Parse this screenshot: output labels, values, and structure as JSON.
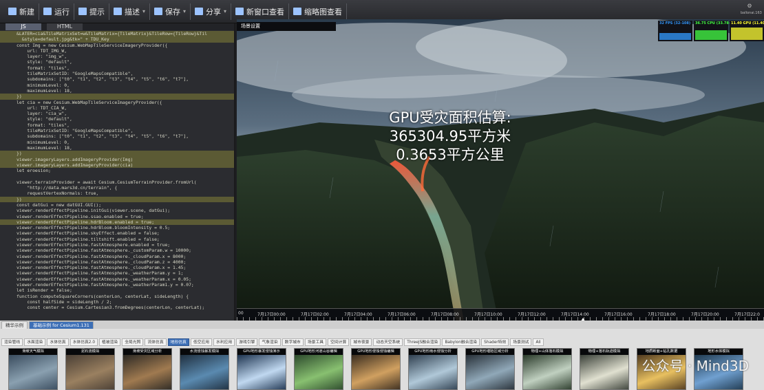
{
  "toolbar": {
    "buttons": [
      {
        "label": "新建",
        "icon": "new-file-icon"
      },
      {
        "label": "运行",
        "icon": "run-icon"
      },
      {
        "label": "提示",
        "icon": "hint-icon"
      },
      {
        "label": "描述",
        "icon": "describe-icon",
        "dropdown": true
      },
      {
        "label": "保存",
        "icon": "save-icon",
        "dropdown": true
      },
      {
        "label": "分享",
        "icon": "share-icon",
        "dropdown": true
      },
      {
        "label": "新窗口查看",
        "icon": "new-window-icon"
      },
      {
        "label": "缩略图查看",
        "icon": "thumbnail-icon"
      }
    ],
    "logo_text": "ballonai.163"
  },
  "editor": {
    "tabs": [
      "JS",
      "HTML"
    ],
    "active_tab": "JS",
    "lines": [
      {
        "n": "",
        "t": "&LATER=cia&TileMatrixSet=w&TileMatrix={TileMatrix}&TileRow={TileRow}&Til",
        "hl": true
      },
      {
        "n": "",
        "t": "  &style=default.jpg&tk=\" + TDU_Key",
        "hl": true
      },
      {
        "n": "",
        "t": "const Img = new Cesium.WebMapTileServiceImageryProvider({",
        "hl": false
      },
      {
        "n": "",
        "t": "    url: TDT_IMG_W,",
        "hl": false
      },
      {
        "n": "",
        "t": "    layer: \"img_w\",",
        "hl": false
      },
      {
        "n": "",
        "t": "    style: \"default\",",
        "hl": false
      },
      {
        "n": "",
        "t": "    format: \"tiles\",",
        "hl": false
      },
      {
        "n": "",
        "t": "    tileMatrixSetID: \"GoogleMapsCompatible\",",
        "hl": false
      },
      {
        "n": "",
        "t": "    subdomains: [\"t0\", \"t1\", \"t2\", \"t3\", \"t4\", \"t5\", \"t6\", \"t7\"],",
        "hl": false
      },
      {
        "n": "",
        "t": "    minimumLevel: 0,",
        "hl": false
      },
      {
        "n": "",
        "t": "    maximumLevel: 18,",
        "hl": false
      },
      {
        "n": "",
        "t": "})",
        "hl": true
      },
      {
        "n": "",
        "t": "let cia = new Cesium.WebMapTileServiceImageryProvider({",
        "hl": false
      },
      {
        "n": "",
        "t": "    url: TDT_CIA_W,",
        "hl": false
      },
      {
        "n": "",
        "t": "    layer: \"cia_w\",",
        "hl": false
      },
      {
        "n": "",
        "t": "    style: \"default\",",
        "hl": false
      },
      {
        "n": "",
        "t": "    format: \"tiles\",",
        "hl": false
      },
      {
        "n": "",
        "t": "    tileMatrixSetID: \"GoogleMapsCompatible\",",
        "hl": false
      },
      {
        "n": "",
        "t": "    subdomains: [\"t0\", \"t1\", \"t2\", \"t3\", \"t4\", \"t5\", \"t6\", \"t7\"],",
        "hl": false
      },
      {
        "n": "",
        "t": "    minimumLevel: 0,",
        "hl": false
      },
      {
        "n": "",
        "t": "    maximumLevel: 18,",
        "hl": false
      },
      {
        "n": "",
        "t": "})",
        "hl": true
      },
      {
        "n": "",
        "t": "viewer.imageryLayers.addImageryProvider(Img)",
        "hl": true
      },
      {
        "n": "",
        "t": "viewer.imageryLayers.addImageryProvider(cia)",
        "hl": true
      },
      {
        "n": "",
        "t": "let eroesion;",
        "hl": false
      },
      {
        "n": "",
        "t": "",
        "hl": false
      },
      {
        "n": "",
        "t": "viewer.terrainProvider = await Cesium.CesiumTerrainProvider.fromUrl(",
        "hl": false
      },
      {
        "n": "",
        "t": "    \"http://data.mars3d.cn/terrain\", {",
        "hl": false
      },
      {
        "n": "",
        "t": "    requestVertexNormals: true,",
        "hl": false
      },
      {
        "n": "",
        "t": "})",
        "hl": true
      },
      {
        "n": "",
        "t": "const datGui = new datGUI.GUI();",
        "hl": false
      },
      {
        "n": "",
        "t": "viewer.renderEffectPipeline.initGui(viewer.scene, datGui);",
        "hl": false
      },
      {
        "n": "",
        "t": "viewer.renderEffectPipeline.ssao.enabled = true;",
        "hl": false
      },
      {
        "n": "",
        "t": "viewer.renderEffectPipeline.hdrBloom.enabled = true;",
        "hl": true
      },
      {
        "n": "",
        "t": "viewer.renderEffectPipeline.hdrBloom.bloomIntensity = 0.5;",
        "hl": false
      },
      {
        "n": "",
        "t": "viewer.renderEffectPipeline.skyEffect.enabled = false;",
        "hl": false
      },
      {
        "n": "",
        "t": "viewer.renderEffectPipeline.tiltshift.enabled = false;",
        "hl": false
      },
      {
        "n": "",
        "t": "viewer.renderEffectPipeline.fastAtmosphere.enabled = true;",
        "hl": false
      },
      {
        "n": "",
        "t": "viewer.renderEffectPipeline.fastAtmosphere._customParam.w = 10000;",
        "hl": false
      },
      {
        "n": "",
        "t": "viewer.renderEffectPipeline.fastAtmosphere._cloudParam.x = 8000;",
        "hl": false
      },
      {
        "n": "",
        "t": "viewer.renderEffectPipeline.fastAtmosphere._cloudParam.z = 4000;",
        "hl": false
      },
      {
        "n": "",
        "t": "viewer.renderEffectPipeline.fastAtmosphere._cloudParam.x = 1.45;",
        "hl": false
      },
      {
        "n": "",
        "t": "viewer.renderEffectPipeline.fastAtmosphere._weatherParam.y = 1;",
        "hl": false
      },
      {
        "n": "",
        "t": "viewer.renderEffectPipeline.fastAtmosphere._weatherParam.x = 0.05;",
        "hl": false
      },
      {
        "n": "",
        "t": "viewer.renderEffectPipeline.fastAtmosphere._weatherParam1.y = 0.07;",
        "hl": false
      },
      {
        "n": "",
        "t": "let isRender = false;",
        "hl": false
      },
      {
        "n": "",
        "t": "function computeSquareCorners(centerLon, centerLat, sideLength) {",
        "hl": false
      },
      {
        "n": "",
        "t": "    const halfSide = sideLength / 2;",
        "hl": false
      },
      {
        "n": "",
        "t": "    const center = Cesium.Cartesian3.fromDegrees(centerLon, centerLat);",
        "hl": false
      }
    ]
  },
  "scene": {
    "label": "场景设置",
    "perf": [
      "32 FPS (32-108)",
      "36.75 CPU (33.78-43)",
      "11.40 GPU (11.40-27)"
    ],
    "overlay": [
      "GPU受灾面积估算:",
      "365304.95平方米",
      "0.3653平方公里"
    ]
  },
  "timeline": {
    "ticks": [
      "00",
      "7月17日00:00",
      "7月17日02:00",
      "7月17日04:00",
      "7月17日06:00",
      "7月17日08:00",
      "7月17日10:00",
      "7月17日12:00",
      "7月17日14:00",
      "7月17日16:00",
      "7月17日18:00",
      "7月17日20:00",
      "7月17日22:0"
    ]
  },
  "bottom": {
    "tabs1": [
      "精华示例",
      "基础示例 for Cesium1.131"
    ],
    "tabs2": [
      "渲染管线",
      "水面渲染",
      "水体仿真",
      "水体仿真2.0",
      "植被渲染",
      "全局光照",
      "流体仿真",
      "地形仿真",
      "低空应用",
      "水利应用",
      "游戏引擎",
      "气象渲染",
      "数字城市",
      "场景工具",
      "空间计算",
      "城市夜景",
      "动态天空系统",
      "ThreeJS融合渲染",
      "Babylon融合渲染",
      "Shader特效",
      "场景测试",
      "All"
    ],
    "active_tab2": "地形仿真",
    "cards": [
      "滑坡天气模拟",
      "泥石流模拟",
      "滑坡受灾区域分析",
      "水流侵蚀暴发模拟",
      "GPU地形暴发侵蚀演示",
      "GPU地形河道山谷编辑",
      "GPU地形侵蚀侵蚀编辑",
      "GPU地形雨水侵蚀分析",
      "GPU地形堪陷区域分析",
      "物理+山体落石模拟",
      "物理+落石轨迹模拟",
      "地质断面+钻孔数据",
      "地形水体模拟"
    ],
    "watermark": "公众号 · Mind3D"
  }
}
